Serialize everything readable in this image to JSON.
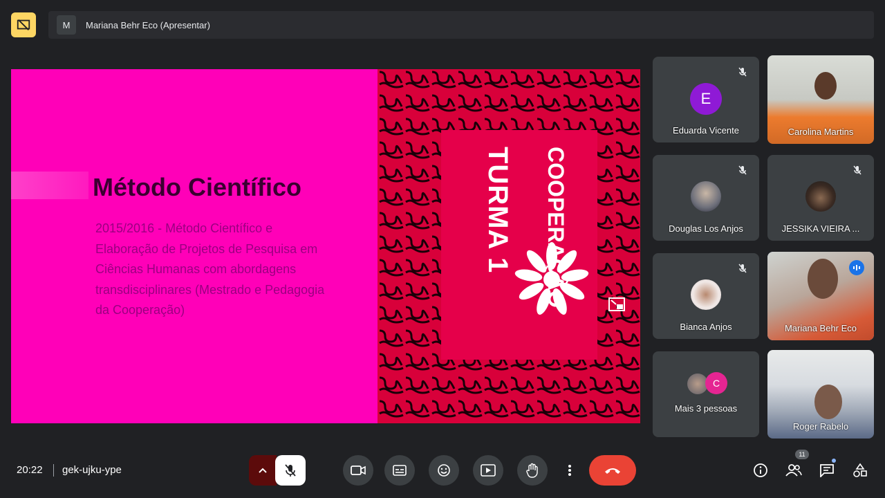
{
  "presenter_bar": {
    "initial": "M",
    "presenter_name": "Mariana Behr Eco (Apresentar)"
  },
  "slide": {
    "title": "Método Científico",
    "body": "2015/2016 - Método Científico e Elaboração de Projetos de Pesquisa em Ciências Humanas com abordagens transdisciplinares (Mestrado e Pedagogia da Cooperação)",
    "turma_text": "TURMA 1",
    "logo_text": "COOPERAÇÃO",
    "colors": {
      "left_bg": "#ff00b8",
      "right_bg": "#d8003a"
    }
  },
  "participants": [
    {
      "name": "Eduarda Vicente",
      "initial": "E",
      "muted": true,
      "type": "letter",
      "avatar_color": "#8f1ad6"
    },
    {
      "name": "Carolina Martins",
      "muted": false,
      "type": "video"
    },
    {
      "name": "Douglas Los Anjos",
      "muted": true,
      "type": "photo"
    },
    {
      "name": "JESSIKA VIEIRA ...",
      "muted": true,
      "type": "photo"
    },
    {
      "name": "Bianca Anjos",
      "muted": true,
      "type": "photo"
    },
    {
      "name": "Mariana Behr Eco",
      "muted": false,
      "type": "video",
      "speaking": true
    },
    {
      "name": "Mais 3 pessoas",
      "initial": "C",
      "type": "group"
    },
    {
      "name": "Roger Rabelo",
      "muted": false,
      "type": "video"
    }
  ],
  "bottom_bar": {
    "time": "20:22",
    "meeting_code": "gek-ujku-ype",
    "participant_count": "11",
    "icons": [
      "chevron-up-icon",
      "mic-off-icon",
      "camera-icon",
      "captions-icon",
      "emoji-icon",
      "present-icon",
      "hand-icon",
      "more-icon",
      "end-call-icon",
      "info-icon",
      "people-icon",
      "chat-icon",
      "activities-icon"
    ],
    "accent": "#ea4335"
  }
}
